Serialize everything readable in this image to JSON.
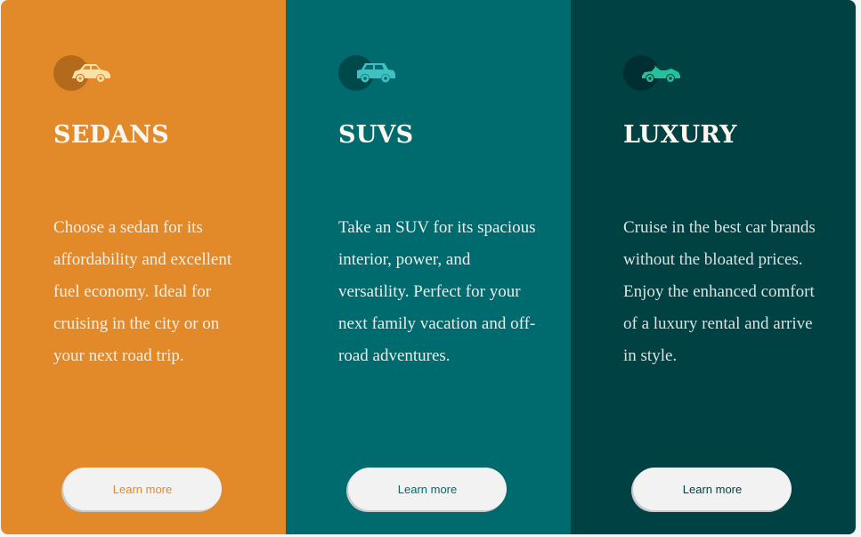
{
  "cards": [
    {
      "title": "SEDANS",
      "description": "Choose a sedan for its affordability and excellent fuel economy. Ideal for cruising in the city or on your next road trip.",
      "button_label": "Learn more",
      "icon": "sedan-car-icon",
      "color": "#e2892a"
    },
    {
      "title": "SUVS",
      "description": "Take an SUV for its spacious interior, power, and versatility. Perfect for your next family vacation and off-road adventures.",
      "button_label": "Learn more",
      "icon": "suv-car-icon",
      "color": "#006b6e"
    },
    {
      "title": "LUXURY",
      "description": "Cruise in the best car brands without the bloated prices. Enjoy the enhanced comfort of a luxury rental and arrive in style.",
      "button_label": "Learn more",
      "icon": "luxury-car-icon",
      "color": "#004143"
    }
  ]
}
